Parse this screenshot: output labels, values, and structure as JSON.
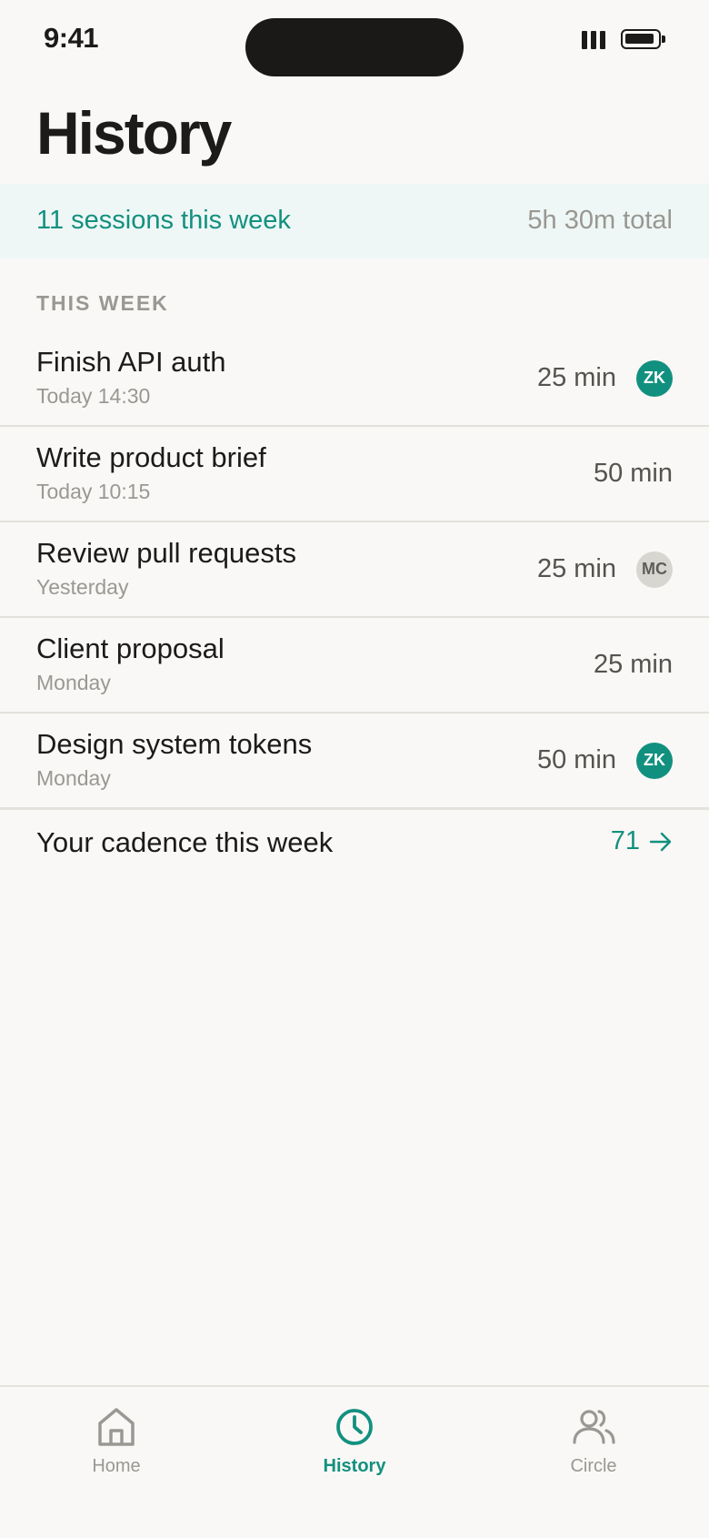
{
  "status": {
    "time": "9:41"
  },
  "header": {
    "title": "History"
  },
  "summary": {
    "sessions": "11 sessions this week",
    "total": "5h 30m total"
  },
  "section": {
    "label": "THIS WEEK"
  },
  "sessions": [
    {
      "title": "Finish API auth",
      "when": "Today 14:30",
      "duration": "25 min",
      "avatar": "ZK",
      "avatar_style": "teal"
    },
    {
      "title": "Write product brief",
      "when": "Today 10:15",
      "duration": "50 min",
      "avatar": "",
      "avatar_style": ""
    },
    {
      "title": "Review pull requests",
      "when": "Yesterday",
      "duration": "25 min",
      "avatar": "MC",
      "avatar_style": "grey"
    },
    {
      "title": "Client proposal",
      "when": "Monday",
      "duration": "25 min",
      "avatar": "",
      "avatar_style": ""
    },
    {
      "title": "Design system tokens",
      "when": "Monday",
      "duration": "50 min",
      "avatar": "ZK",
      "avatar_style": "teal"
    }
  ],
  "cadence": {
    "label": "Your cadence this week",
    "value": "71"
  },
  "tabs": [
    {
      "label": "Home",
      "icon": "home-icon",
      "active": false
    },
    {
      "label": "History",
      "icon": "clock-icon",
      "active": true
    },
    {
      "label": "Circle",
      "icon": "people-icon",
      "active": false
    }
  ],
  "colors": {
    "accent": "#13907f",
    "background": "#f9f8f6",
    "summary_bg": "#eef7f6",
    "muted": "#9a9893"
  }
}
